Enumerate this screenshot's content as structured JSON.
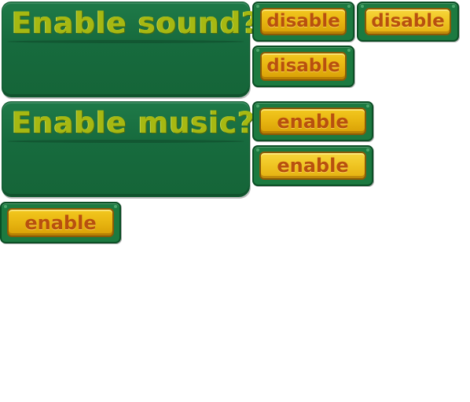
{
  "panels": {
    "sound": {
      "title": "Enable sound?"
    },
    "music": {
      "title": "Enable music?"
    }
  },
  "buttons": {
    "disable": [
      "disable",
      "disable",
      "disable"
    ],
    "enable": [
      "enable",
      "enable",
      "enable"
    ]
  },
  "colors": {
    "panel_green": "#176b3e",
    "title_text": "#a6b812",
    "button_frame": "#1c7a40",
    "button_fill": "#e9b712",
    "button_text": "#b8500f",
    "background": "#ffffff"
  }
}
